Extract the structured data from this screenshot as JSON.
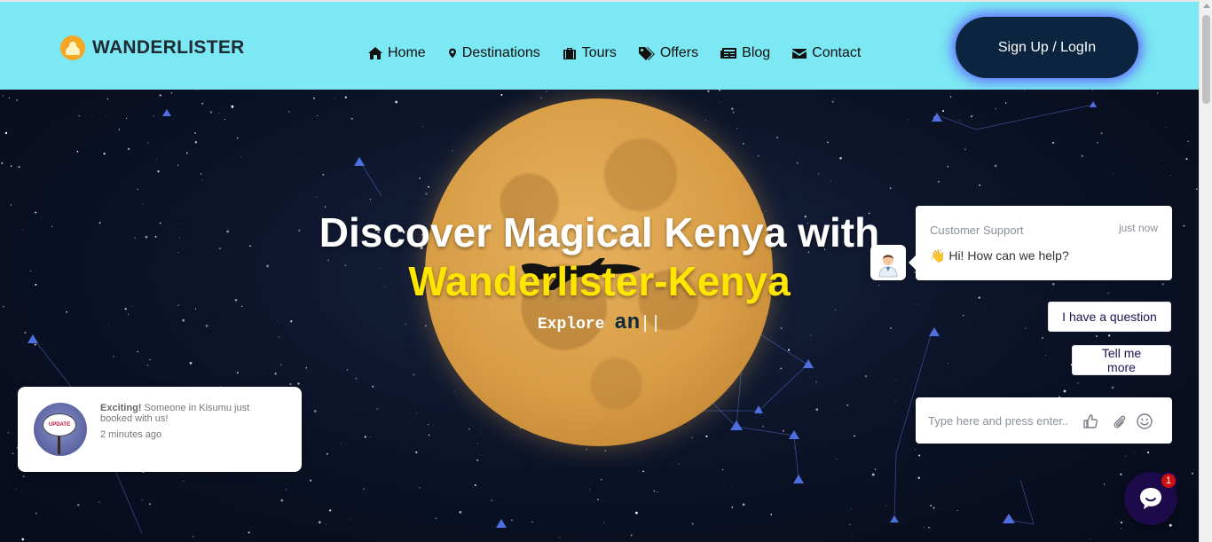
{
  "header": {
    "logo_text": "WANDERLISTER",
    "nav": [
      {
        "label": "Home",
        "icon": "home-icon"
      },
      {
        "label": "Destinations",
        "icon": "map-marker-icon"
      },
      {
        "label": "Tours",
        "icon": "suitcase-icon"
      },
      {
        "label": "Offers",
        "icon": "tags-icon"
      },
      {
        "label": "Blog",
        "icon": "newspaper-icon"
      },
      {
        "label": "Contact",
        "icon": "envelope-icon"
      }
    ],
    "signup_label": "Sign Up / LogIn"
  },
  "hero": {
    "title_line1": "Discover Magical Kenya with",
    "title_line2": "Wanderlister-Kenya",
    "sub_static": "Explore",
    "sub_typed": "an",
    "sub_caret": "||"
  },
  "notification": {
    "image_text": "UPDATE",
    "label": "Exciting!",
    "message": "Someone in Kisumu just booked with us!",
    "time": "2 minutes ago"
  },
  "chat": {
    "agent": "Customer Support",
    "time": "just now",
    "emoji": "👋",
    "message": "Hi! How can we help?",
    "quick_replies": [
      "I have a question",
      "Tell me more"
    ],
    "input_placeholder": "Type here and press enter..",
    "badge_count": "1"
  },
  "colors": {
    "header_bg": "#7ce8f3",
    "accent_yellow": "#ffe600",
    "button_dark": "#0b2440",
    "chat_launcher": "#1c0a4a"
  }
}
